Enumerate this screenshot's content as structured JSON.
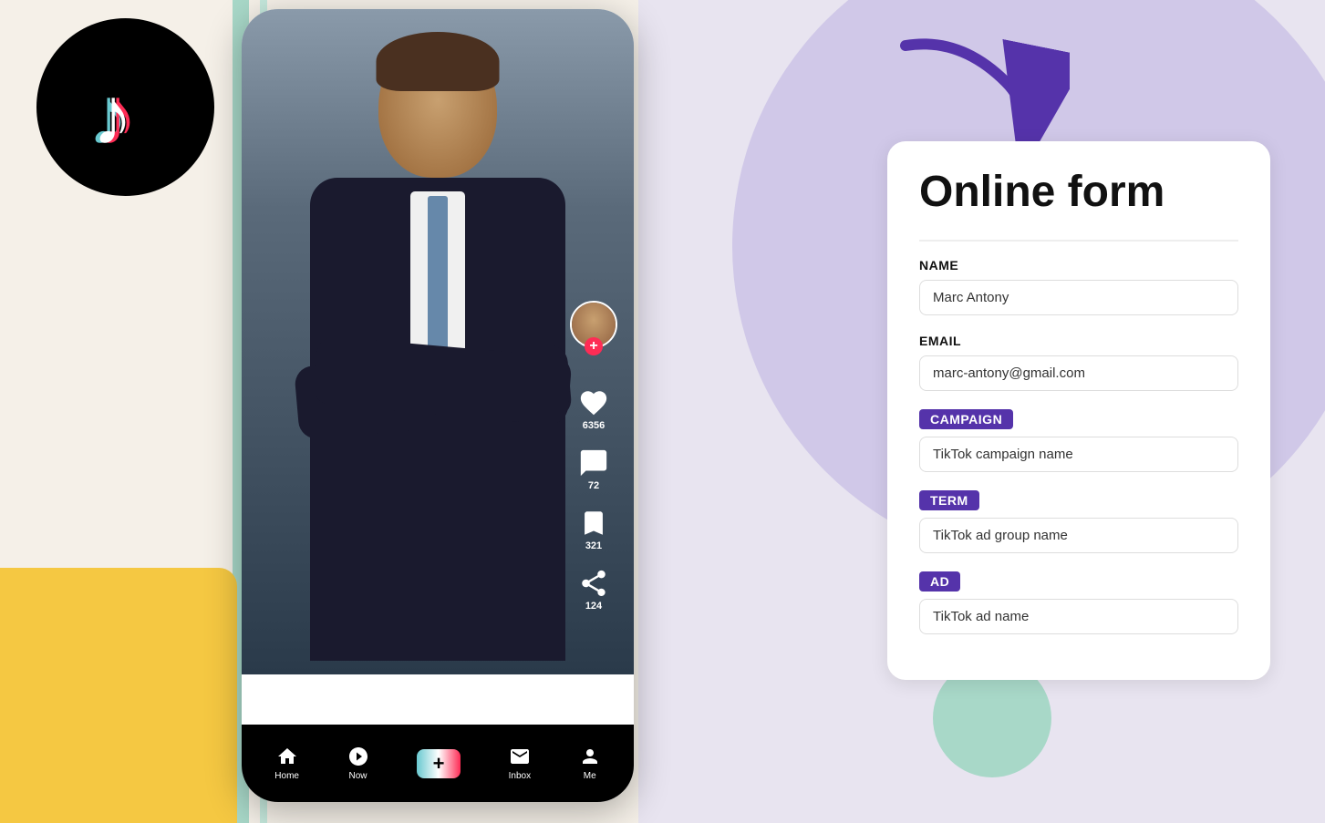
{
  "background": {
    "left_color": "#f5f0e8",
    "right_color": "#e8e4f0",
    "yellow_color": "#f5c842",
    "circle_color": "#d0c8e8",
    "green_color": "#a8d8c8"
  },
  "tiktok": {
    "logo_bg": "#000000"
  },
  "phone": {
    "nav_items": [
      {
        "label": "Home",
        "icon": "home"
      },
      {
        "label": "Now",
        "icon": "compass"
      },
      {
        "label": "+",
        "icon": "plus"
      },
      {
        "label": "Inbox",
        "icon": "chat"
      },
      {
        "label": "Me",
        "icon": "person"
      }
    ],
    "stats": {
      "likes": "6356",
      "comments": "72",
      "bookmarks": "321",
      "shares": "124"
    }
  },
  "form": {
    "title": "Online form",
    "fields": [
      {
        "label": "NAME",
        "label_type": "plain",
        "value": "Marc Antony"
      },
      {
        "label": "EMAIL",
        "label_type": "plain",
        "value": "marc-antony@gmail.com"
      },
      {
        "label": "CAMPAIGN",
        "label_type": "highlight",
        "value": "TikTok campaign name"
      },
      {
        "label": "TERM",
        "label_type": "highlight",
        "value": "TikTok ad group name"
      },
      {
        "label": "AD",
        "label_type": "highlight",
        "value": "TikTok ad name"
      }
    ]
  }
}
